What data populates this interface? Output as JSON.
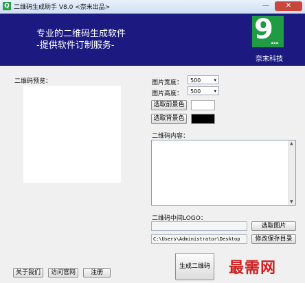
{
  "window": {
    "title": "二维码生成助手 V8.0 <奈末出品>",
    "icon_char": "Q",
    "minimize_glyph": "—",
    "close_glyph": "✕"
  },
  "banner": {
    "line1": "专业的二维码生成软件",
    "line2": "-提供软件订制服务-",
    "logo_digit": "9",
    "logo_dots": "...",
    "logo_text": "奈末科技"
  },
  "preview": {
    "label": "二维码预览："
  },
  "settings": {
    "width_label": "图片宽度：",
    "width_value": "500",
    "height_label": "图片高度：",
    "height_value": "500",
    "fg_button": "选取前景色",
    "fg_color": "#ffffff",
    "bg_button": "选取背景色",
    "bg_color": "#000000",
    "dropdown_arrow": "▾"
  },
  "content": {
    "label": "二维码内容：",
    "value": ""
  },
  "logo_section": {
    "label": "二维码中间LOGO：",
    "logo_path": "",
    "pick_image_button": "选取图片",
    "save_dir": "C:\\Users\\Administrator\\Desktop",
    "change_dir_button": "修改保存目录"
  },
  "footer": {
    "about_button": "关于我们",
    "website_button": "访问官网",
    "register_button": "注册",
    "generate_button": "生成二维码"
  },
  "watermark": {
    "text": "最需网"
  }
}
